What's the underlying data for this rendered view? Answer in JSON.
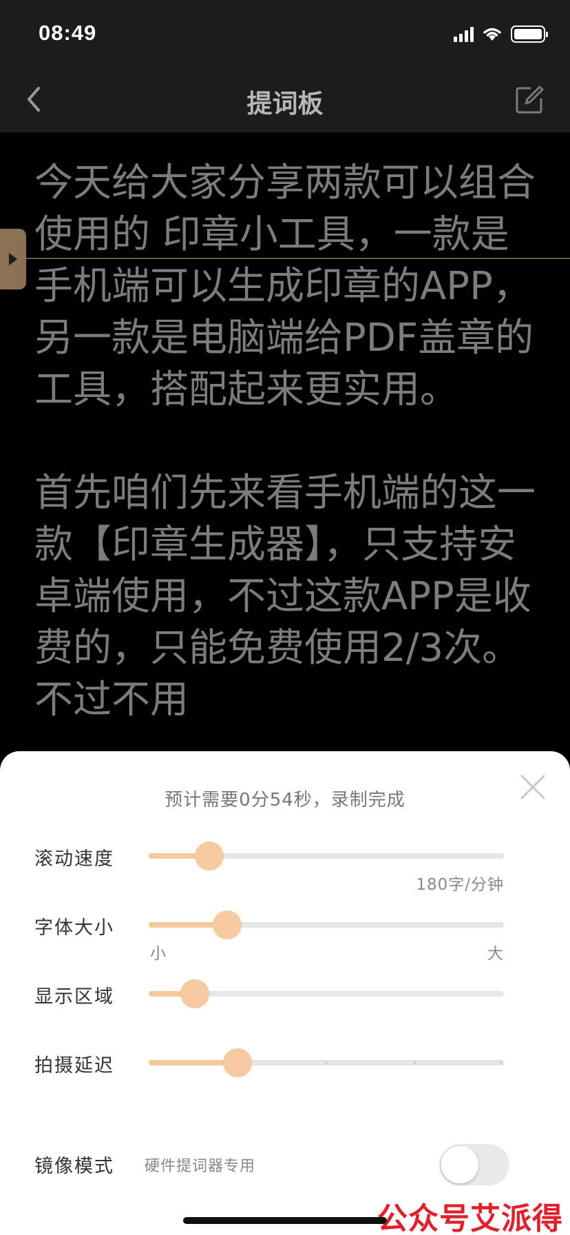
{
  "status": {
    "time": "08:49"
  },
  "nav": {
    "title": "提词板"
  },
  "prompter": {
    "paragraphs": [
      "今天给大家分享两款可以组合使用的 印章小工具，一款是手机端可以生成印章的APP，另一款是电脑端给PDF盖章的工具，搭配起来更实用。",
      "首先咱们先来看手机端的这一款【印章生成器】，只支持安卓端使用，不过这款APP是收费的，只能免费使用2/3次。不过不用"
    ]
  },
  "sheet": {
    "estimate": "预计需要0分54秒，录制完成",
    "sliders": [
      {
        "label": "滚动速度",
        "value_fraction": 0.17,
        "value_text": "180字/分钟"
      },
      {
        "label": "字体大小",
        "value_fraction": 0.22,
        "min_label": "小",
        "max_label": "大"
      },
      {
        "label": "显示区域",
        "value_fraction": 0.13
      },
      {
        "label": "拍摄延迟",
        "value_fraction": 0.25
      }
    ],
    "mirror": {
      "label": "镜像模式",
      "hint": "硬件提词器专用",
      "enabled": false
    }
  },
  "watermark": "公众号艾派得",
  "colors": {
    "accent": "#f6c89a",
    "background": "#000000",
    "bar": "#1c1c1c"
  }
}
